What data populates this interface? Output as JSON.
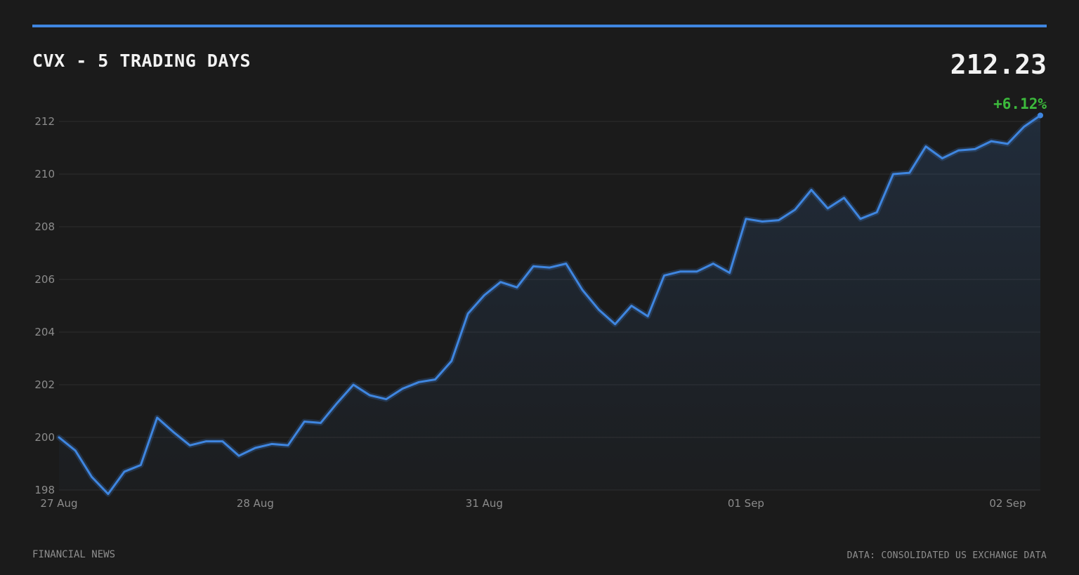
{
  "header": {
    "title": "CVX - 5 TRADING DAYS",
    "price": "212.23",
    "change": "+6.12%"
  },
  "footer": {
    "source_left": "FINANCIAL NEWS",
    "source_right": "DATA: CONSOLIDATED US EXCHANGE DATA"
  },
  "colors": {
    "accent": "#3f86e0",
    "positive": "#3cba3c",
    "background": "#1b1b1b",
    "grid": "#2e2e2e"
  },
  "chart_data": {
    "type": "area",
    "title": "CVX - 5 TRADING DAYS",
    "xlabel": "",
    "ylabel": "",
    "ylim": [
      198,
      212.7
    ],
    "y_ticks": [
      198,
      200,
      202,
      204,
      206,
      208,
      210,
      212
    ],
    "x_ticks": [
      {
        "label": "27 Aug",
        "index": 0
      },
      {
        "label": "28 Aug",
        "index": 12
      },
      {
        "label": "31 Aug",
        "index": 26
      },
      {
        "label": "01 Sep",
        "index": 42
      },
      {
        "label": "02 Sep",
        "index": 58
      }
    ],
    "grid": true,
    "series": [
      {
        "values": [
          200.0,
          199.5,
          198.5,
          197.85,
          198.7,
          198.95,
          200.75,
          200.2,
          199.7,
          199.85,
          199.85,
          199.3,
          199.6,
          199.75,
          199.7,
          200.6,
          200.55,
          201.3,
          202.0,
          201.6,
          201.45,
          201.85,
          202.1,
          202.2,
          202.9,
          204.7,
          205.4,
          205.9,
          205.7,
          206.5,
          206.45,
          206.6,
          205.6,
          204.85,
          204.3,
          205.0,
          204.6,
          206.15,
          206.3,
          206.3,
          206.6,
          206.25,
          208.3,
          208.2,
          208.25,
          208.65,
          209.4,
          208.7,
          209.1,
          208.3,
          208.55,
          210.0,
          210.05,
          211.05,
          210.6,
          210.9,
          210.95,
          211.25,
          211.15,
          211.8,
          212.23
        ]
      }
    ]
  }
}
